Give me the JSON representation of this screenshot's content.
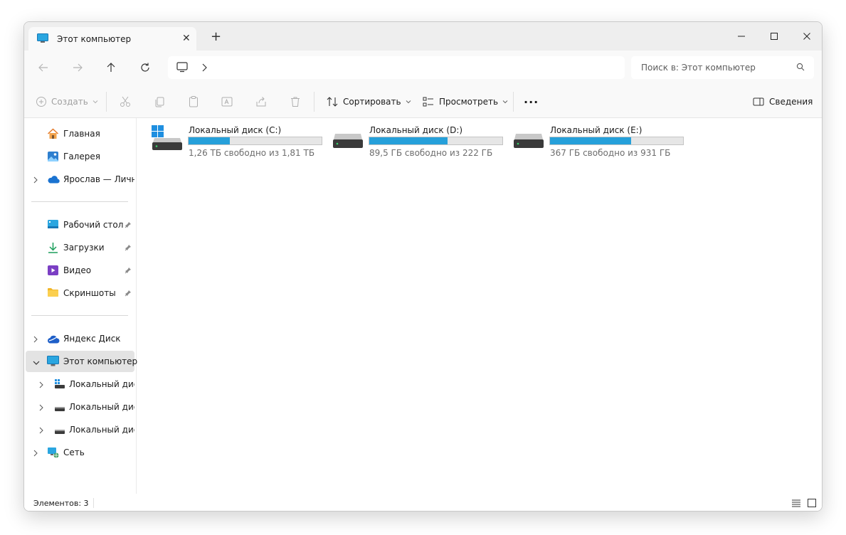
{
  "tab": {
    "title": "Этот компьютер",
    "close": "✕",
    "new": "+"
  },
  "search": {
    "placeholder": "Поиск в: Этот компьютер"
  },
  "toolbar": {
    "create": "Создать",
    "sort": "Сортировать",
    "view": "Просмотреть",
    "more": "···",
    "details": "Сведения"
  },
  "sidebar": {
    "quick": [
      {
        "label": "Главная"
      },
      {
        "label": "Галерея"
      },
      {
        "label": "Ярослав — Личное"
      }
    ],
    "pinned": [
      {
        "label": "Рабочий стол"
      },
      {
        "label": "Загрузки"
      },
      {
        "label": "Видео"
      },
      {
        "label": "Скриншоты"
      }
    ],
    "tree": [
      {
        "label": "Яндекс Диск"
      },
      {
        "label": "Этот компьютер"
      },
      {
        "label": "Локальный диск (C:)"
      },
      {
        "label": "Локальный диск (D:)"
      },
      {
        "label": "Локальный диск (E:)"
      },
      {
        "label": "Сеть"
      }
    ]
  },
  "drives": [
    {
      "name": "Локальный диск (C:)",
      "info": "1,26 ТБ свободно из 1,81 ТБ",
      "used_fraction": 0.31
    },
    {
      "name": "Локальный диск (D:)",
      "info": "89,5 ГБ свободно из 222 ГБ",
      "used_fraction": 0.59
    },
    {
      "name": "Локальный диск (E:)",
      "info": "367 ГБ свободно из 931 ГБ",
      "used_fraction": 0.61
    }
  ],
  "status": {
    "items": "Элементов: 3"
  },
  "colors": {
    "accent": "#26a0da",
    "selected": "#e3e3e3"
  }
}
